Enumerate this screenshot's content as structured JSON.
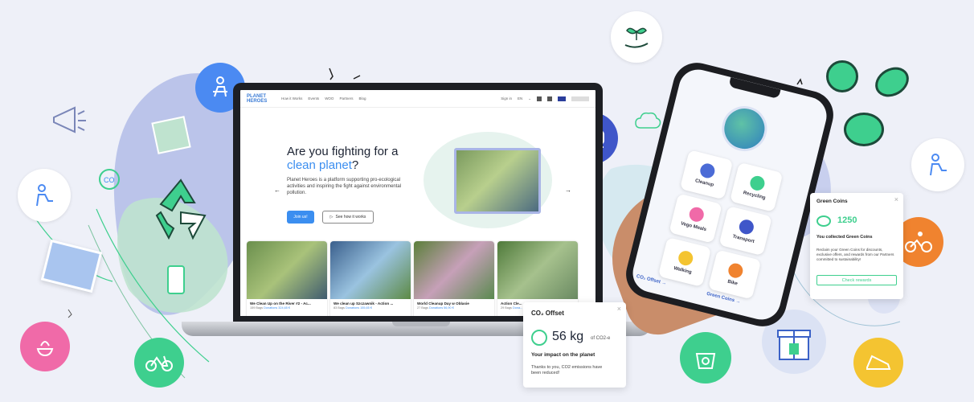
{
  "colors": {
    "brand": "#3b8ef0",
    "green": "#3ecf8e",
    "lilac": "#a9b5e6",
    "bg": "#eef0f8"
  },
  "laptop": {
    "logo": [
      "PLANET",
      "HEROES"
    ],
    "nav_items": [
      "How it Works",
      "Events",
      "WOO",
      "Partners",
      "Blog"
    ],
    "sign_in": "Sign in",
    "lang": "EN",
    "hero_title_1": "Are you fighting for a",
    "hero_title_accent": "clean planet",
    "hero_title_end": "?",
    "hero_text": "Planet Heroes is a platform supporting pro-ecological activities and inspiring the fight against environmental pollution.",
    "join_label": "Join us!",
    "how_label": "See how it works",
    "prev_arrow": "←",
    "next_arrow": "→",
    "cards": [
      {
        "title": "We Clean Up on the River #2 - Ac...",
        "meta": "159 Bags",
        "donation": "Donations 324,65 €"
      },
      {
        "title": "We clean up Szczawnik - Action ...",
        "meta": "83 Bags",
        "donation": "Donations 155,65 €"
      },
      {
        "title": "World Cleanup Day w Oblasie",
        "meta": "27 Bags",
        "donation": "Donations 56,90 €"
      },
      {
        "title": "Action Cle...",
        "meta": "29 Bags",
        "donation": "Dona..."
      }
    ]
  },
  "phone": {
    "tiles": [
      {
        "label": "Cleanup",
        "color": "#4b6bd6"
      },
      {
        "label": "Recycling",
        "color": "#3ecf8e"
      },
      {
        "label": "Vego Meals",
        "color": "#f06aa8"
      },
      {
        "label": "Transport",
        "color": "#3f56c9"
      },
      {
        "label": "Walking",
        "color": "#f4c431"
      },
      {
        "label": "Bike",
        "color": "#f0832f"
      }
    ],
    "co2_label": "CO₂ Offset",
    "coins_label": "Green Coins"
  },
  "co2_popup": {
    "title": "CO₂ Offset",
    "close": "×",
    "value": "56 kg",
    "unit": "of CO2-e",
    "subtitle": "Your impact on the planet",
    "text": "Thanks to you, CO2 emissions have been reduced!"
  },
  "coins_popup": {
    "title": "Green Coins",
    "close": "×",
    "value": "1250",
    "collected": "You collected Green Coins",
    "text": "Reclaim your Green Coins for discounts, exclusive offers, and rewards from our Partners committed to sustainability!",
    "button": "Check rewards"
  }
}
